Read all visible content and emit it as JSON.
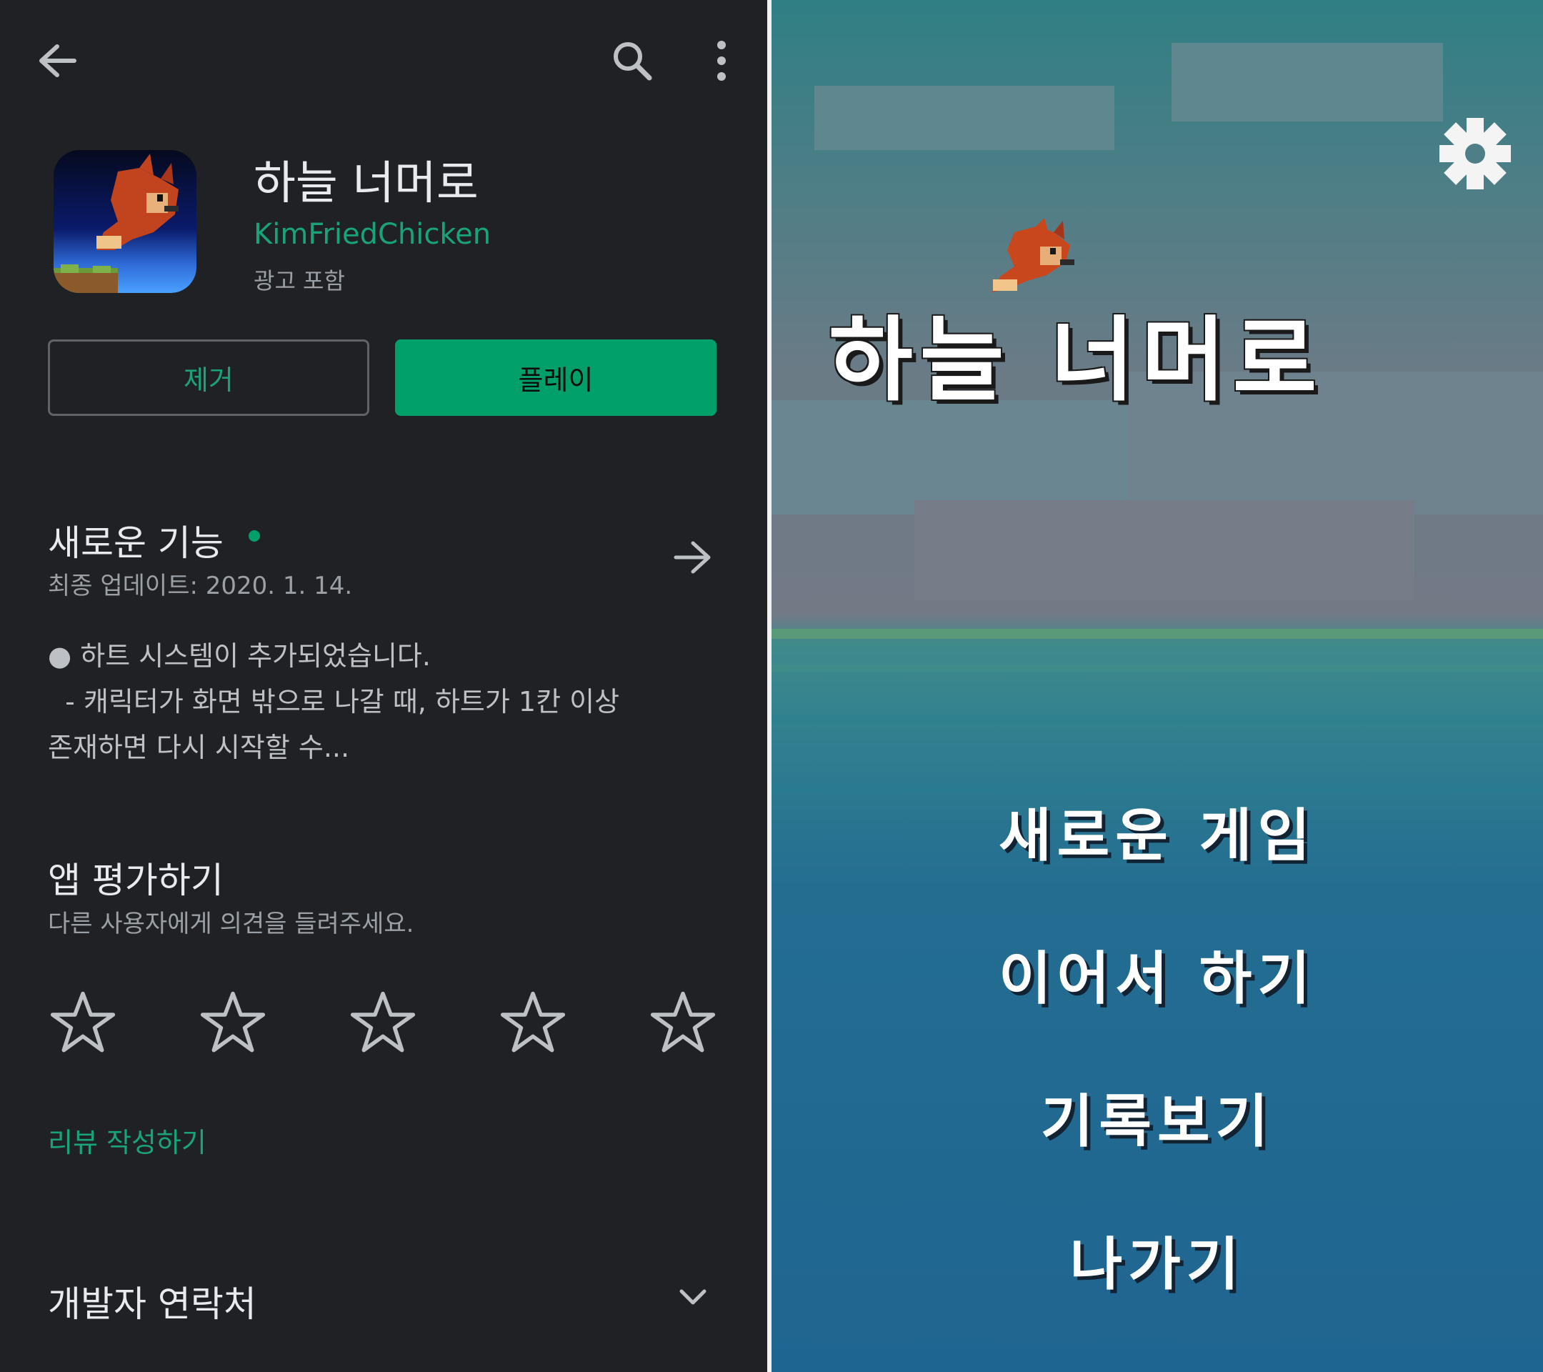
{
  "store": {
    "app_title": "하늘 너머로",
    "developer": "KimFriedChicken",
    "contains_ads": "광고 포함",
    "uninstall_label": "제거",
    "play_label": "플레이",
    "whats_new": {
      "heading": "새로운 기능",
      "last_updated": "최종 업데이트: 2020. 1. 14.",
      "line1": "● 하트 시스템이 추가되었습니다.",
      "line2": "  - 캐릭터가 화면 밖으로 나갈 때, 하트가 1칸 이상",
      "line3": "존재하면 다시 시작할 수..."
    },
    "rate": {
      "heading": "앱 평가하기",
      "subtitle": "다른 사용자에게 의견을 들려주세요.",
      "stars": 5,
      "write_review": "리뷰 작성하기"
    },
    "developer_contact": "개발자 연락처"
  },
  "game": {
    "title": "하늘 너머로",
    "menu": [
      "새로운 게임",
      "이어서 하기",
      "기록보기",
      "나가기"
    ]
  },
  "icons": [
    "back-arrow-icon",
    "search-icon",
    "more-vert-icon",
    "arrow-right-icon",
    "chevron-down-icon",
    "star-outline-icon",
    "gear-icon"
  ],
  "colors": {
    "accent": "#01a06b",
    "store_bg": "#202124"
  }
}
